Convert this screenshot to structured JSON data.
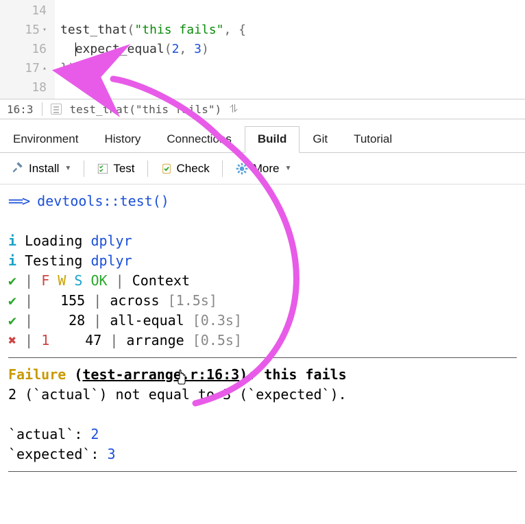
{
  "editor": {
    "lines": [
      {
        "num": "14",
        "fold": "",
        "tokens": []
      },
      {
        "num": "15",
        "fold": "▾",
        "tokens": [
          {
            "t": "test_that",
            "c": "fn"
          },
          {
            "t": "(",
            "c": "paren"
          },
          {
            "t": "\"this fails\"",
            "c": "str"
          },
          {
            "t": ", {",
            "c": "paren"
          }
        ]
      },
      {
        "num": "16",
        "fold": "",
        "cursor": true,
        "tokens": [
          {
            "t": "  ",
            "c": ""
          },
          {
            "t": "expect_equal",
            "c": "fn"
          },
          {
            "t": "(",
            "c": "paren"
          },
          {
            "t": "2",
            "c": "num"
          },
          {
            "t": ", ",
            "c": "paren"
          },
          {
            "t": "3",
            "c": "num"
          },
          {
            "t": ")",
            "c": "paren"
          }
        ]
      },
      {
        "num": "17",
        "fold": "▴",
        "tokens": [
          {
            "t": "})",
            "c": "paren"
          }
        ]
      },
      {
        "num": "18",
        "fold": "",
        "tokens": []
      }
    ]
  },
  "statusbar": {
    "pos": "16:3",
    "crumb": "test_that(\"this fails\")",
    "updown": "⇡⇣"
  },
  "tabs": [
    "Environment",
    "History",
    "Connections",
    "Build",
    "Git",
    "Tutorial"
  ],
  "active_tab": "Build",
  "toolbar": {
    "install": "Install",
    "test": "Test",
    "check": "Check",
    "more": "More"
  },
  "console": {
    "prompt": "⟹",
    "cmd": "devtools::test()",
    "loading": "Loading",
    "testing": "Testing",
    "pkg": "dplyr",
    "header": {
      "F": "F",
      "W": "W",
      "S": "S",
      "OK": "OK",
      "ctx": "Context"
    },
    "rows": [
      {
        "ok": "✔",
        "f": "",
        "n": "155",
        "ctx": "across",
        "t": "[1.5s]"
      },
      {
        "ok": "✔",
        "f": "",
        "n": "28",
        "ctx": "all-equal",
        "t": "[0.3s]"
      },
      {
        "ok": "✖",
        "f": "1",
        "n": "47",
        "ctx": "arrange",
        "t": "[0.5s]"
      }
    ],
    "failure": {
      "label": "Failure",
      "link": "test-arrange.r:16:3",
      "msg": "this fails",
      "detail": "2 (`actual`) not equal to 3 (`expected`).",
      "actual_label": "  `actual`:",
      "actual_val": "2",
      "expected_label": "`expected`:",
      "expected_val": "3"
    }
  }
}
